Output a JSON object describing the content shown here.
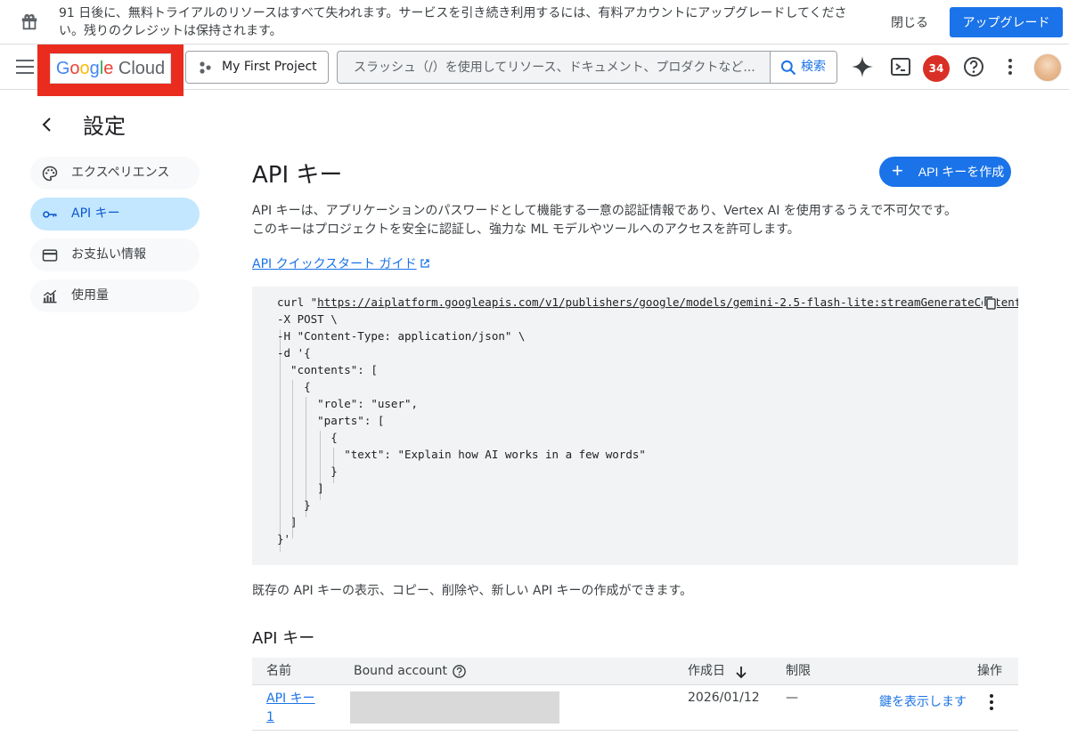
{
  "banner": {
    "message": "91 日後に、無料トライアルのリソースはすべて失われます。サービスを引き続き利用するには、有料アカウントにアップグレードしてください。残りのクレジットは保持されます。",
    "close_label": "閉じる",
    "upgrade_label": "アップグレード"
  },
  "topbar": {
    "logo": {
      "g": "G",
      "o1": "o",
      "o2": "o",
      "g2": "g",
      "l": "l",
      "e": "e",
      "cloud": "Cloud"
    },
    "project_name": "My First Project",
    "search_placeholder": "スラッシュ（/）を使用してリソース、ドキュメント、プロダクトなど...",
    "search_button": "検索",
    "notification_count": "34"
  },
  "settings": {
    "title": "設定",
    "nav": [
      {
        "label": "エクスペリエンス",
        "icon": "palette-icon"
      },
      {
        "label": "API キー",
        "icon": "key-icon",
        "active": true
      },
      {
        "label": "お支払い情報",
        "icon": "credit-card-icon"
      },
      {
        "label": "使用量",
        "icon": "chart-icon"
      }
    ]
  },
  "main": {
    "title": "API キー",
    "create_button": "API キーを作成",
    "description": "API キーは、アプリケーションのパスワードとして機能する一意の認証情報であり、Vertex AI を使用するうえで不可欠です。このキーはプロジェクトを安全に認証し、強力な ML モデルやツールへのアクセスを許可します。",
    "quickstart_link": "API クイックスタート ガイド",
    "code": {
      "prefix": "curl \"",
      "url": "https://aiplatform.googleapis.com/v1/publishers/google/models/gemini-2.5-flash-lite:streamGenerateContent",
      "rest": "\n-X POST \\\n-H \"Content-Type: application/json\" \\\n-d '{\n  \"contents\": [\n    {\n      \"role\": \"user\",\n      \"parts\": [\n        {\n          \"text\": \"Explain how AI works in a few words\"\n        }\n      ]\n    }\n  ]\n}'"
    },
    "manage_text": "既存の API キーの表示、コピー、削除や、新しい API キーの作成ができます。",
    "section_title": "API キー",
    "table": {
      "headers": {
        "name": "名前",
        "bound_account": "Bound account",
        "created": "作成日",
        "restrictions": "制限",
        "actions": "操作"
      },
      "rows": [
        {
          "name": "API キー 1",
          "created": "2026/01/12",
          "restrictions": "—",
          "show_key": "鍵を表示します"
        }
      ]
    }
  }
}
